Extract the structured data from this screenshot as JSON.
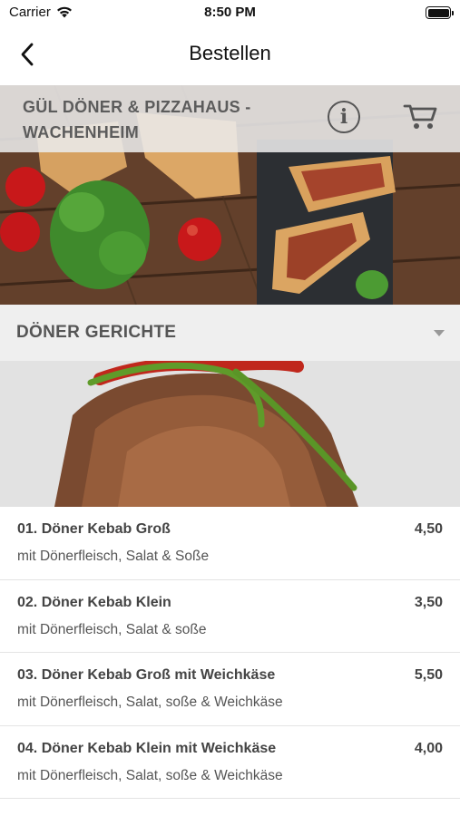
{
  "status_bar": {
    "carrier": "Carrier",
    "time": "8:50 PM",
    "battery_level": 1.0
  },
  "nav": {
    "title": "Bestellen",
    "back_icon": "chevron-left-icon"
  },
  "restaurant": {
    "name": "GÜL DÖNER & PIZZAHAUS - WACHENHEIM",
    "info_icon": "info-icon",
    "info_label": "i",
    "cart_icon": "cart-icon"
  },
  "category": {
    "title": "DÖNER GERICHTE",
    "chevron_icon": "chevron-down-icon"
  },
  "menu_items": [
    {
      "name": "01. Döner Kebab Groß",
      "price": "4,50",
      "description": "mit Dönerfleisch, Salat & Soße"
    },
    {
      "name": "02. Döner Kebab Klein",
      "price": "3,50",
      "description": "mit Dönerfleisch, Salat & soße"
    },
    {
      "name": "03. Döner Kebab Groß mit Weichkäse",
      "price": "5,50",
      "description": "mit Dönerfleisch, Salat, soße & Weichkäse"
    },
    {
      "name": "04. Döner Kebab Klein mit Weichkäse",
      "price": "4,00",
      "description": "mit Dönerfleisch, Salat, soße & Weichkäse"
    }
  ],
  "colors": {
    "accent_text": "#5c5c5c",
    "category_bg": "#efefef",
    "divider": "#e4e4e4"
  }
}
